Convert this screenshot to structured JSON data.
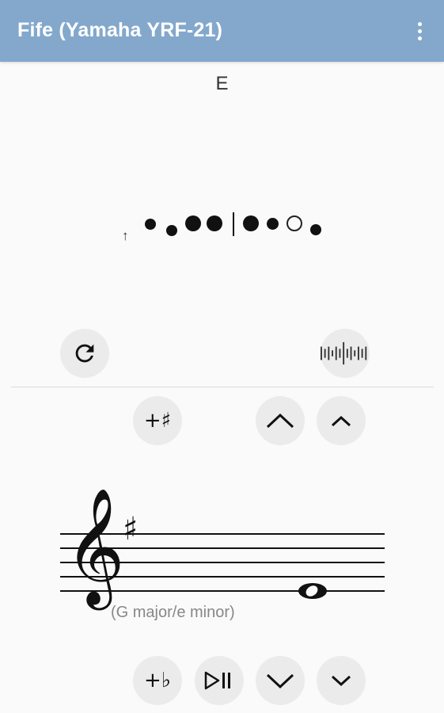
{
  "appbar": {
    "title": "Fife (Yamaha YRF-21)",
    "menu_icon": "overflow-menu-icon"
  },
  "note": {
    "name": "E"
  },
  "fingering": {
    "holes": [
      "closed",
      "closed",
      "closed",
      "closed",
      "closed",
      "closed",
      "open",
      "closed"
    ],
    "arrow_glyph": "↑"
  },
  "controls": {
    "reset_icon": "refresh-icon",
    "tuner_icon": "tuner-icon",
    "sharp_label": "+♯",
    "flat_label": "+♭",
    "octave_up_icon": "chevron-up-icon",
    "semitone_up_icon": "chevron-up-small-icon",
    "octave_down_icon": "chevron-down-icon",
    "semitone_down_icon": "chevron-down-small-icon",
    "play_pause_icon": "play-pause-icon"
  },
  "staff": {
    "clef_glyph": "𝄞",
    "key_signature_glyph": "♯",
    "key_label": "(G major/e minor)",
    "note_glyph": "𝅝"
  }
}
